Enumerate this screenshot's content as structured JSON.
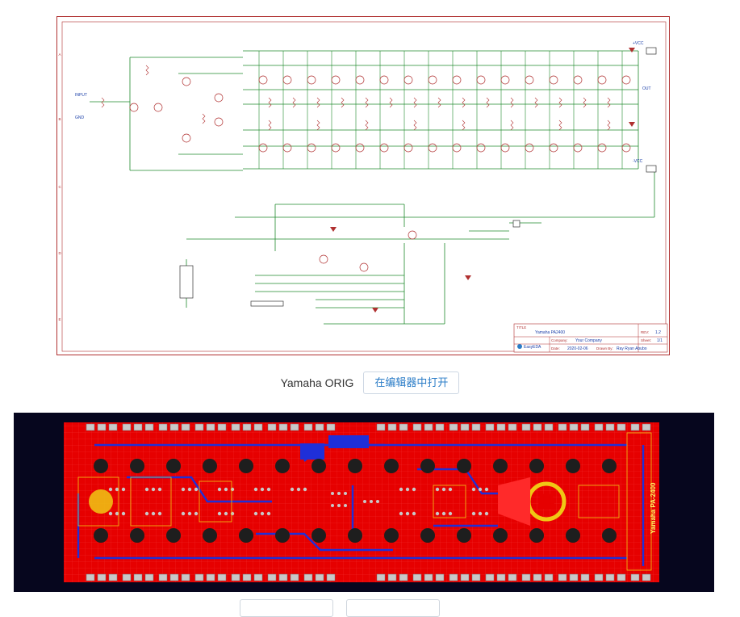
{
  "schematic": {
    "title_block": {
      "title_label": "TITLE",
      "title_value": "Yamaha PA2400",
      "rev_label": "REV:",
      "rev_value": "1.2",
      "company_label": "Company:",
      "company_value": "Your Company",
      "sheet_label": "Sheet:",
      "sheet_value": "1/1",
      "date_label": "Date:",
      "date_value": "2020-02-06",
      "drawn_label": "Drawn By:",
      "drawn_value": "Ray Ryan Abubo",
      "logo_text": "EasyEDA"
    },
    "border_rows": [
      "A",
      "B",
      "C",
      "D",
      "E"
    ],
    "net_labels": [
      "+VCC",
      "-VCC",
      "INPUT",
      "GND",
      "OUT"
    ],
    "colors": {
      "wire": "#1f8a2c",
      "component": "#b03030",
      "text": "#1a3ea8"
    }
  },
  "caption": {
    "title": "Yamaha ORIG",
    "open_button": "在编辑器中打开"
  },
  "pcb": {
    "silkscreen_label": "Yamaha PA-2400",
    "colors": {
      "board": "#e60000",
      "background": "#06061e",
      "pad": "#c8c8c8",
      "hole": "#1e1e1e",
      "bottom_copper": "#1f2fd8",
      "ring": "#f0c814"
    }
  }
}
